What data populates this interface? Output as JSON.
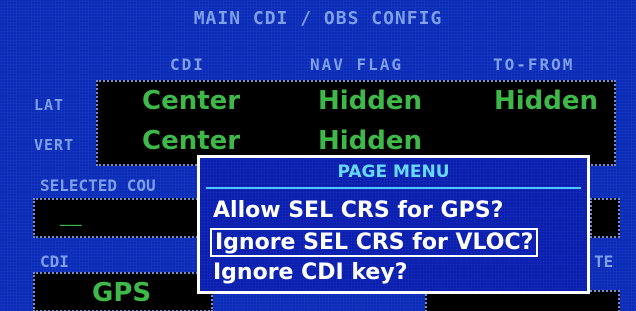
{
  "title": "MAIN CDI / OBS CONFIG",
  "headers": {
    "cdi": "CDI",
    "nav_flag": "NAV FLAG",
    "to_from": "TO-FROM"
  },
  "rows": {
    "lat": {
      "label": "LAT",
      "cdi": "Center",
      "nav_flag": "Hidden",
      "to_from": "Hidden"
    },
    "vert": {
      "label": "VERT",
      "cdi": "Center",
      "nav_flag": "Hidden"
    }
  },
  "selected_course": {
    "label": "SELECTED COU",
    "value": "___"
  },
  "cdi_section": {
    "label": "CDI",
    "value": "GPS",
    "right_label_fragment": "TE"
  },
  "page_menu": {
    "title": "PAGE MENU",
    "items": [
      {
        "label": "Allow SEL CRS for GPS?",
        "selected": false
      },
      {
        "label": "Ignore SEL CRS for VLOC?",
        "selected": true
      },
      {
        "label": "Ignore CDI key?",
        "selected": false
      }
    ]
  },
  "colors": {
    "background": "#0a2cb8",
    "label": "#7f9fe6",
    "value_green": "#3fb84a",
    "menu_title": "#66d9ff",
    "menu_text": "#ffffff"
  }
}
